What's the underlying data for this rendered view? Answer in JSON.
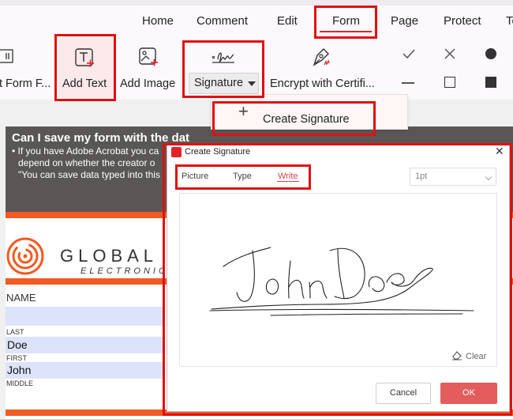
{
  "menu": {
    "items": [
      {
        "label": "Home"
      },
      {
        "label": "Comment"
      },
      {
        "label": "Edit"
      },
      {
        "label": "Form"
      },
      {
        "label": "Page"
      },
      {
        "label": "Protect"
      },
      {
        "label": "Te"
      }
    ],
    "active": "Form"
  },
  "toolbar": {
    "tools": [
      {
        "label": "t Form F...",
        "icon": "form-field-icon"
      },
      {
        "label": "Add Text",
        "icon": "add-text-icon"
      },
      {
        "label": "Add Image",
        "icon": "add-image-icon"
      },
      {
        "label": "Signature",
        "icon": "signature-icon"
      },
      {
        "label": "Encrypt with Certifi...",
        "icon": "encrypt-certificate-icon"
      }
    ],
    "marks": [
      "check-icon",
      "cross-icon",
      "dot-icon",
      "line-icon",
      "square-outline-icon",
      "square-filled-icon"
    ]
  },
  "signature_menu": {
    "item_label": "Create Signature"
  },
  "document": {
    "banner_heading": "Can I save my form with the dat",
    "banner_lines": [
      "• If you have Adobe Acrobat you ca",
      "depend on whether the creator o",
      "\"You can save data typed into this"
    ],
    "logo_text": "GLOBAL",
    "logo_sub": "ELECTRONIC",
    "name_label": "NAME",
    "last_label": "LAST",
    "last_value": "Doe",
    "first_label": "FIRST",
    "first_value": "John",
    "middle_label": "MIDDLE"
  },
  "dialog": {
    "title": "Create Signature",
    "tabs": [
      {
        "label": "Picture"
      },
      {
        "label": "Type"
      },
      {
        "label": "Write"
      }
    ],
    "active_tab": "Write",
    "stroke_width": "1pt",
    "clear_label": "Clear",
    "cancel_label": "Cancel",
    "ok_label": "OK",
    "drawn_signature": "John Doe"
  },
  "colors": {
    "accent_red": "#e2232a",
    "highlight": "#e01010",
    "ok_button": "#e35d5d",
    "banner": "#5b5656",
    "orange": "#f05a23",
    "field": "#dde3fb"
  }
}
